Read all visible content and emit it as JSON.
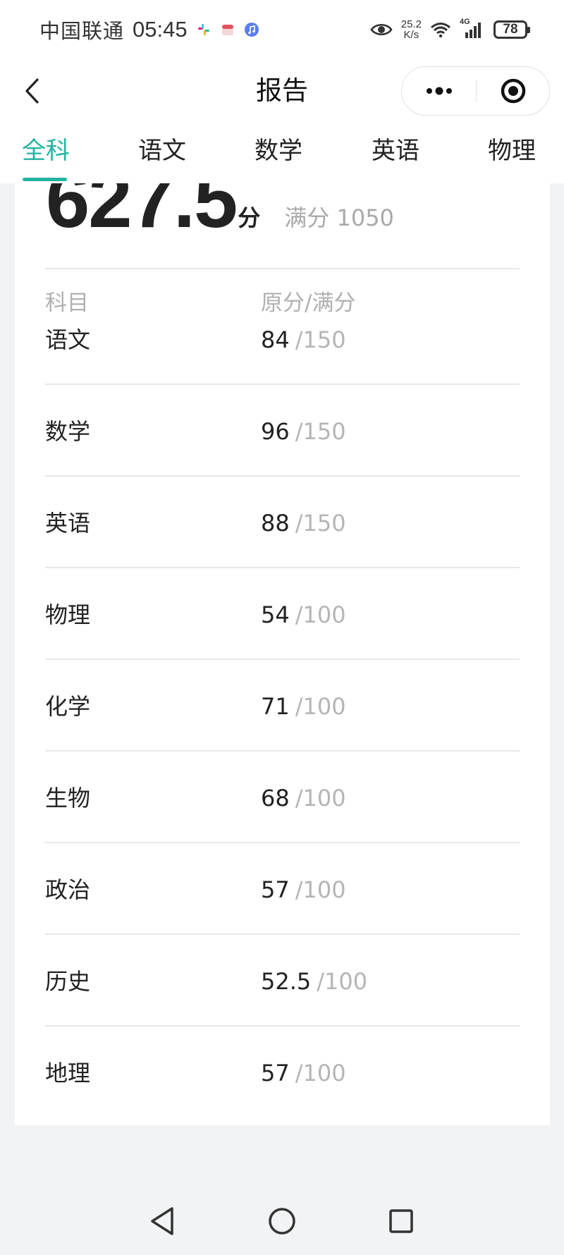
{
  "status_bar": {
    "carrier": "中国联通",
    "time": "05:45",
    "net_speed_value": "25.2",
    "net_speed_unit": "K/s",
    "network": "4G",
    "battery": "78"
  },
  "header": {
    "title": "报告",
    "back_icon": "chevron-left-icon",
    "more_icon": "more-dots-icon",
    "close_icon": "target-icon"
  },
  "tabs": [
    {
      "label": "全科",
      "active": true
    },
    {
      "label": "语文",
      "active": false
    },
    {
      "label": "数学",
      "active": false
    },
    {
      "label": "英语",
      "active": false
    },
    {
      "label": "物理",
      "active": false
    }
  ],
  "summary": {
    "total_score": "627.5",
    "unit": "分",
    "full_score_text": "满分 1050"
  },
  "table": {
    "header_subject": "科目",
    "header_score": "原分/满分",
    "rows": [
      {
        "subject": "语文",
        "score": "84",
        "max": "/150"
      },
      {
        "subject": "数学",
        "score": "96",
        "max": "/150"
      },
      {
        "subject": "英语",
        "score": "88",
        "max": "/150"
      },
      {
        "subject": "物理",
        "score": "54",
        "max": "/100"
      },
      {
        "subject": "化学",
        "score": "71",
        "max": "/100"
      },
      {
        "subject": "生物",
        "score": "68",
        "max": "/100"
      },
      {
        "subject": "政治",
        "score": "57",
        "max": "/100"
      },
      {
        "subject": "历史",
        "score": "52.5",
        "max": "/100"
      },
      {
        "subject": "地理",
        "score": "57",
        "max": "/100"
      }
    ]
  },
  "colors": {
    "accent": "#21b3a1",
    "text": "#222222",
    "muted": "#b0b0b0",
    "background": "#f2f3f5"
  },
  "nav_bar": {
    "back_icon": "triangle-back-icon",
    "home_icon": "circle-home-icon",
    "recents_icon": "square-recents-icon"
  }
}
